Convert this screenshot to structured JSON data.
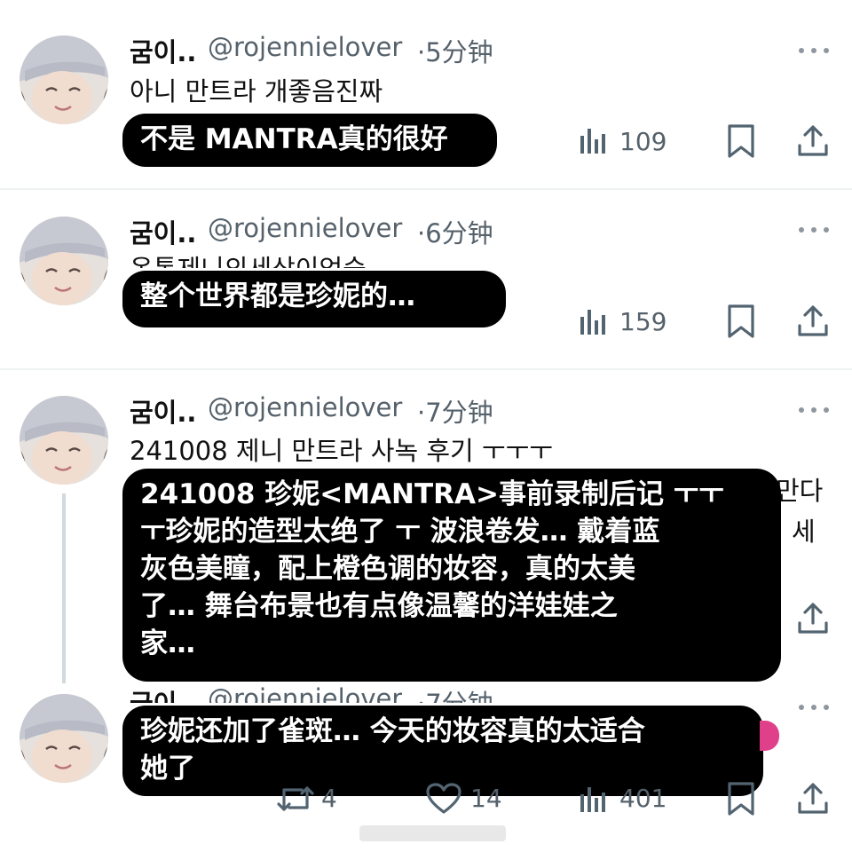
{
  "tweets": [
    {
      "author_name": "굼이..",
      "handle": "@rojennielover",
      "time": "·5分钟",
      "text": "아니 만트라 개좋음진짜",
      "overlay_lines": [
        "不是 MANTRA真的很好"
      ],
      "views": "109"
    },
    {
      "author_name": "굼이..",
      "handle": "@rojennielover",
      "time": "·6分钟",
      "text": "온통제니의세상이었숭",
      "overlay_lines": [
        "整个世界都是珍妮的…"
      ],
      "views": "159"
    },
    {
      "author_name": "굼이..",
      "handle": "@rojennielover",
      "time": "·7分钟",
      "text": "241008 제니 만트라 사녹 후기 ㅜㅜㅜ",
      "side_text": [
        "만다",
        "세"
      ],
      "overlay_lines": [
        "241008 珍妮<MANTRA>事前录制后记 ㅜㅜ",
        "ㅜ珍妮的造型太绝了 ㅜ 波浪卷发… 戴着蓝",
        "灰色美瞳，配上橙色调的妆容，真的太美",
        "了… 舞台布景也有点像温馨的洋娃娃之",
        "家…"
      ]
    },
    {
      "author_name": "굼이..",
      "handle": "@rojennielover",
      "time": "·7分钟",
      "overlay_lines": [
        "珍妮还加了雀斑… 今天的妆容真的太适合",
        "她了"
      ],
      "retweets": "4",
      "likes": "14",
      "views": "401"
    }
  ],
  "colors": {
    "overlay_bg": "#000000",
    "muted": "#55616b",
    "icon": "#536471",
    "divider": "#eff3f4"
  },
  "icons": [
    "views-icon",
    "bookmark-icon",
    "share-icon",
    "retweet-icon",
    "like-icon",
    "more-icon"
  ]
}
